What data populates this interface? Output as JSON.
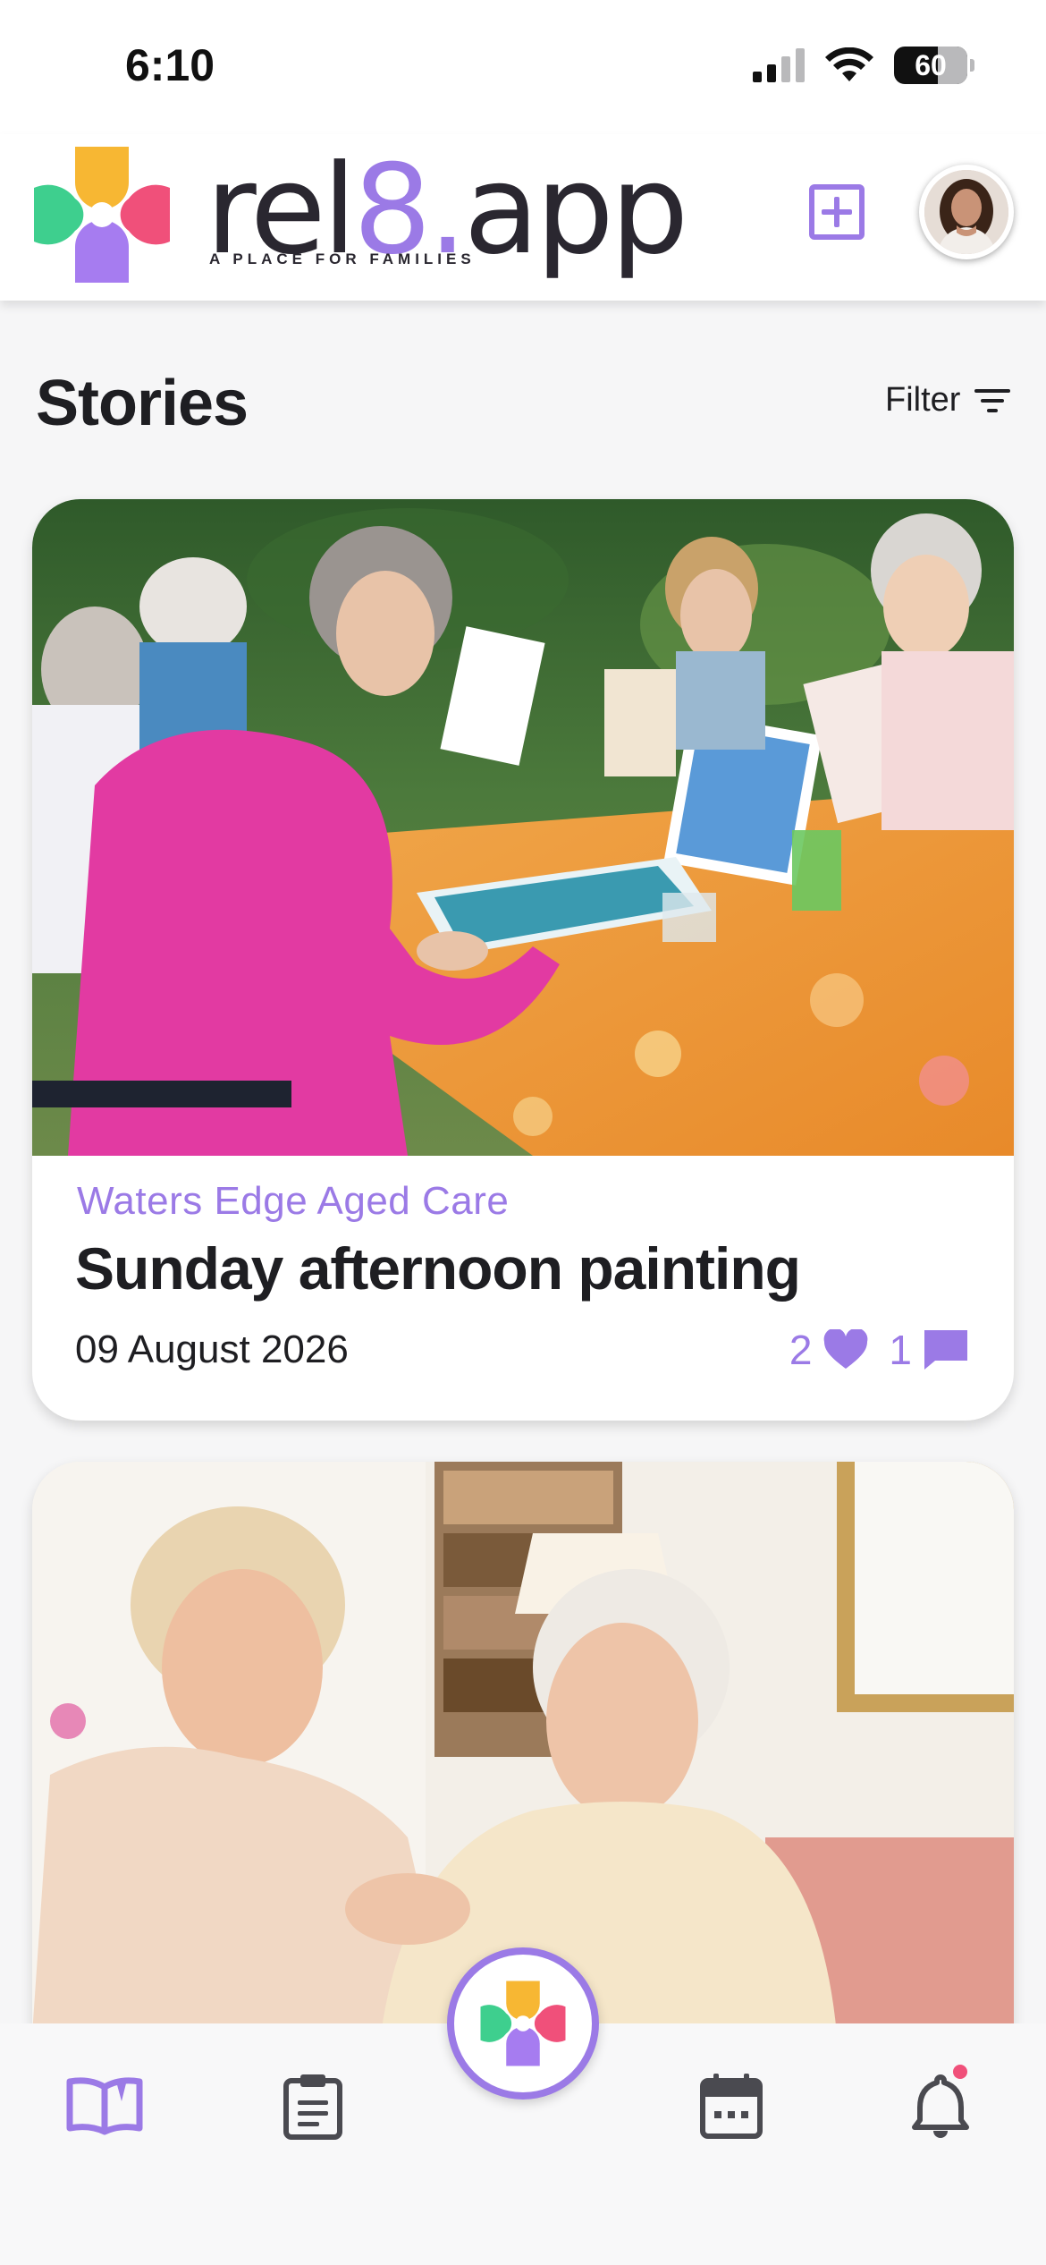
{
  "status_bar": {
    "time": "6:10",
    "battery_percent": 60,
    "battery_label": "60"
  },
  "header": {
    "brand_prefix": "rel",
    "brand_eight": "8",
    "brand_suffix": "app",
    "brand_dot": ".",
    "tagline": "A PLACE FOR FAMILIES",
    "accent_color": "#9b7ae6"
  },
  "page": {
    "title": "Stories",
    "filter_label": "Filter"
  },
  "stories": [
    {
      "location": "Waters Edge Aged Care",
      "title": "Sunday afternoon painting",
      "date": "09 August 2026",
      "likes": "2",
      "comments": "1"
    }
  ],
  "nav": {
    "items": [
      "stories-icon",
      "posts-icon",
      "home-logo",
      "calendar-icon",
      "notifications-icon"
    ],
    "active": "stories-icon",
    "notification_dot_color": "#f0507a"
  }
}
